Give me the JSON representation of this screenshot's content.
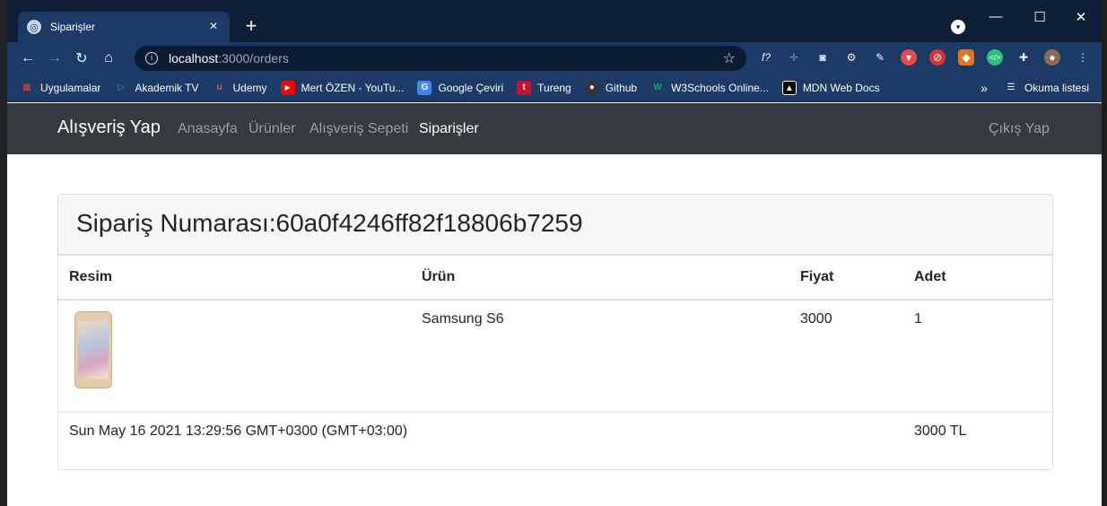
{
  "browser": {
    "tab_title": "Siparişler",
    "url_host": "localhost",
    "url_path": ":3000/orders",
    "bookmarks": [
      {
        "label": "Uygulamalar",
        "icon": "apps-grid-icon",
        "color": "#ea4335"
      },
      {
        "label": "Akademik TV",
        "icon": "akademik-tv-icon",
        "color": "#4a90e2"
      },
      {
        "label": "Udemy",
        "icon": "udemy-icon",
        "color": "#ec5252"
      },
      {
        "label": "Mert ÖZEN - YouTu...",
        "icon": "youtube-icon",
        "color": "#ff0000"
      },
      {
        "label": "Google Çeviri",
        "icon": "google-translate-icon",
        "color": "#4285f4"
      },
      {
        "label": "Tureng",
        "icon": "tureng-icon",
        "color": "#c4122f"
      },
      {
        "label": "Github",
        "icon": "github-icon",
        "color": "#333333"
      },
      {
        "label": "W3Schools Online...",
        "icon": "w3schools-icon",
        "color": "#04aa6d"
      },
      {
        "label": "MDN Web Docs",
        "icon": "mdn-icon",
        "color": "#000000"
      }
    ],
    "reading_list": "Okuma listesi"
  },
  "navbar": {
    "brand": "Alışveriş Yap",
    "links": [
      "Anasayfa",
      "Ürünler",
      "Alışveriş Sepeti",
      "Siparişler"
    ],
    "active": "Siparişler",
    "logout": "Çıkış Yap"
  },
  "order": {
    "title": "Sipariş Numarası:60a0f4246ff82f18806b7259",
    "headers": {
      "image": "Resim",
      "product": "Ürün",
      "price": "Fiyat",
      "qty": "Adet"
    },
    "items": [
      {
        "product": "Samsung S6",
        "price": "3000",
        "qty": "1",
        "image": "samsung-phone-image"
      }
    ],
    "date": "Sun May 16 2021 13:29:56 GMT+0300 (GMT+03:00)",
    "total": "3000 TL"
  }
}
